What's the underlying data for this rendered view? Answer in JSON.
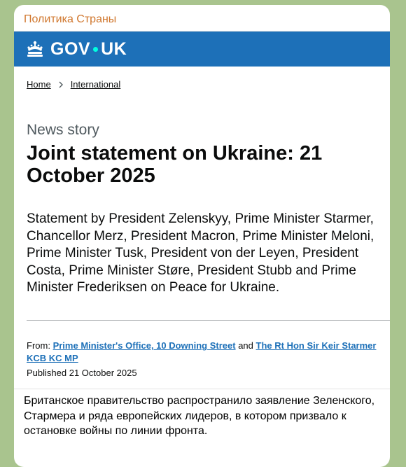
{
  "channel": {
    "name": "Политика Страны"
  },
  "gov": {
    "logo_left": "GOV",
    "logo_right": "UK",
    "breadcrumbs": [
      "Home",
      "International"
    ],
    "kicker": "News story",
    "title": "Joint statement on Ukraine: 21 October 2025",
    "lede": "Statement by President Zelenskyy, Prime Minister Starmer, Chancellor Merz, President Macron, Prime Minister Meloni, Prime Minister Tusk,  President von der Leyen, President Costa, Prime Minister Støre, President Stubb and Prime Minister Frederiksen on Peace for Ukraine.",
    "from_label": "From:",
    "from_org": "Prime Minister's Office, 10 Downing Street",
    "and_label": "and",
    "from_person": "The Rt Hon Sir Keir Starmer KCB KC MP",
    "published_label": "Published",
    "published_date": "21 October 2025"
  },
  "caption": "Британское правительство распространило заявление Зеленского, Стармера и ряда европейских лидеров, в котором призвало к остановке войны по линии фронта."
}
